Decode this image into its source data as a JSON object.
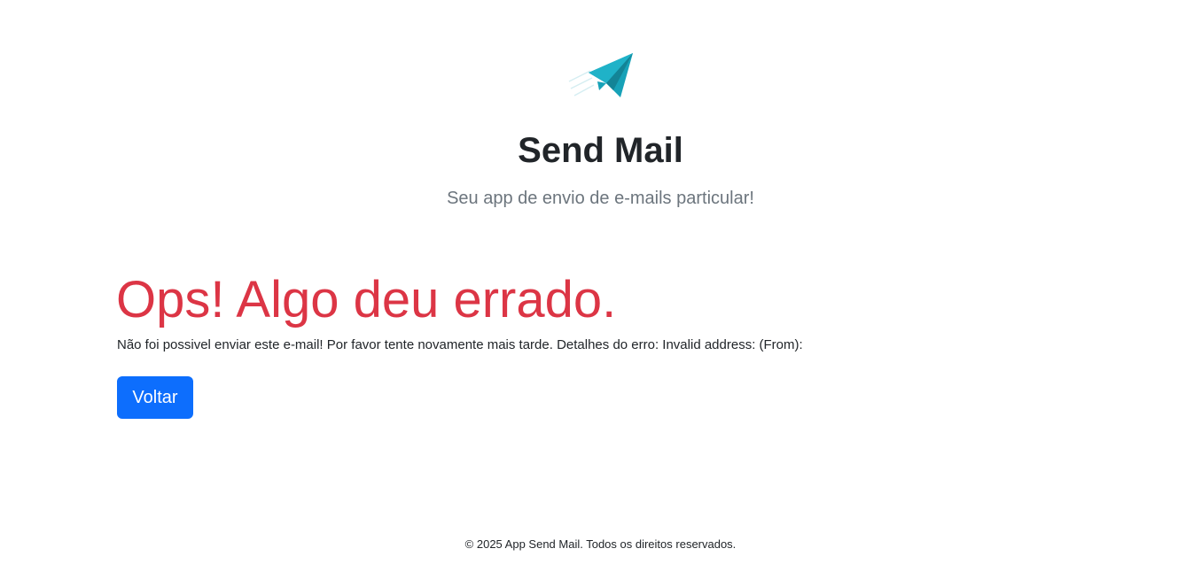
{
  "header": {
    "logo_icon": "paper-plane-icon",
    "title": "Send Mail",
    "subtitle": "Seu app de envio de e-mails particular!"
  },
  "error": {
    "title": "Ops! Algo deu errado.",
    "message": "Não foi possivel enviar este e-mail! Por favor tente novamente mais tarde. Detalhes do erro: Invalid address: (From):",
    "back_button_label": "Voltar"
  },
  "footer": {
    "text": "© 2025 App Send Mail. Todos os direitos reservados."
  },
  "colors": {
    "accent": "#17a2b8",
    "error": "#dc3545",
    "primary_button": "#0d6efd"
  }
}
